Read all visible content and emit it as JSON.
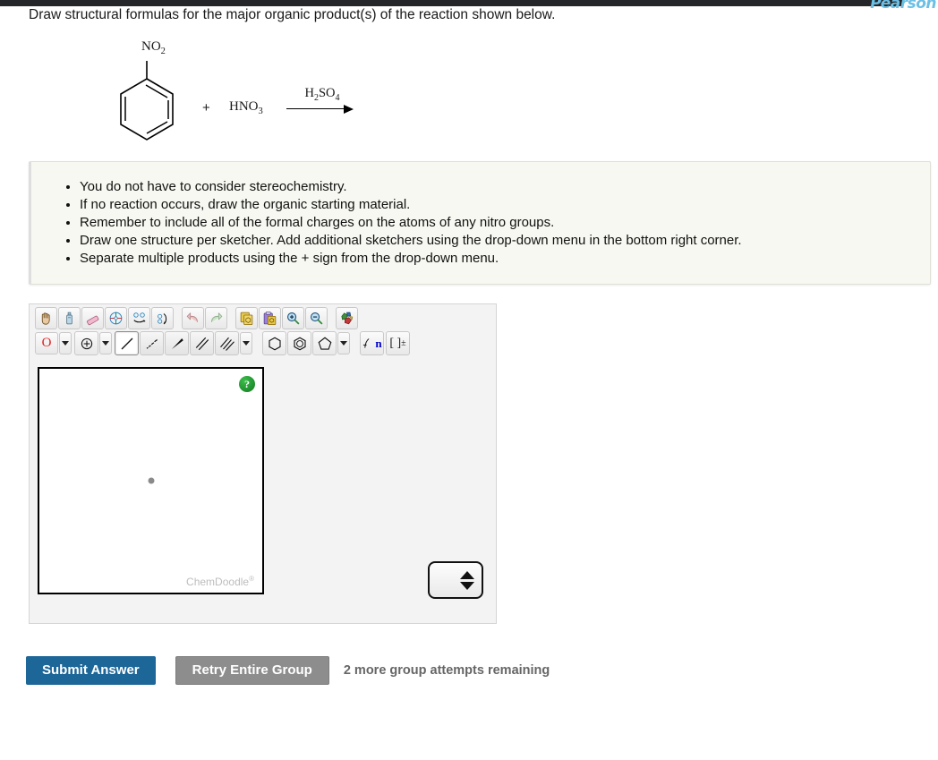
{
  "header": {
    "brand": "Pearson",
    "prompt": "Draw structural formulas for the major organic product(s) of the reaction shown below."
  },
  "reaction": {
    "substituent_label": "NO",
    "substituent_sub": "2",
    "plus": "+",
    "reagent": "HNO",
    "reagent_sub": "3",
    "catalyst": "H",
    "catalyst_sub1": "2",
    "catalyst_mid": "SO",
    "catalyst_sub2": "4",
    "arrow": "reaction-arrow"
  },
  "instructions": {
    "bullets": [
      "You do not have to consider stereochemistry.",
      "If no reaction occurs, draw the organic starting material.",
      "Remember to include all of the formal charges on the atoms of any nitro groups.",
      "Draw one structure per sketcher. Add additional sketchers using the drop-down menu in the bottom right corner.",
      "Separate multiple products using the + sign from the drop-down menu."
    ]
  },
  "sketcher": {
    "toolbar_row1": [
      {
        "name": "pan-hand-icon",
        "label": "Move/Pan"
      },
      {
        "name": "clear-icon",
        "label": "Clear"
      },
      {
        "name": "eraser-icon",
        "label": "Erase"
      },
      {
        "name": "center-icon",
        "label": "Center"
      },
      {
        "name": "flip-horizontal-icon",
        "label": "Flip Horizontal"
      },
      {
        "name": "flip-vertical-icon",
        "label": "Flip Vertical"
      },
      {
        "name": "undo-icon",
        "label": "Undo"
      },
      {
        "name": "redo-icon",
        "label": "Redo"
      },
      {
        "name": "copy-icon",
        "label": "Copy"
      },
      {
        "name": "paste-icon",
        "label": "Paste"
      },
      {
        "name": "zoom-in-icon",
        "label": "Zoom In"
      },
      {
        "name": "zoom-out-icon",
        "label": "Zoom Out"
      },
      {
        "name": "templates-icon",
        "label": "Templates"
      }
    ],
    "atom_label": "O",
    "charge_label": "charge-tool",
    "bond_tools": [
      {
        "name": "single-bond-tool",
        "label": "Single Bond",
        "selected": true
      },
      {
        "name": "hash-bond-tool",
        "label": "Hashed Bond",
        "selected": false
      },
      {
        "name": "wedge-bond-tool",
        "label": "Wedge Bond",
        "selected": false
      },
      {
        "name": "double-bond-tool",
        "label": "Double Bond",
        "selected": false
      },
      {
        "name": "triple-bond-tool",
        "label": "Triple Bond",
        "selected": false
      }
    ],
    "ring_tools": [
      {
        "name": "cyclohexane-ring-tool",
        "label": "Cyclohexane"
      },
      {
        "name": "benzene-ring-tool",
        "label": "Benzene"
      },
      {
        "name": "cyclopentane-ring-tool",
        "label": "Cyclopentane"
      }
    ],
    "chain_label": "n",
    "bracket_label": "[ ]",
    "bracket_sup": "±",
    "help_badge": "?",
    "watermark": "ChemDoodle",
    "watermark_sup": "®",
    "spinner": "add-sketcher-spinner"
  },
  "footer": {
    "submit_label": "Submit Answer",
    "retry_label": "Retry Entire Group",
    "attempts_text": "2 more group attempts remaining"
  },
  "colors": {
    "submit_blue": "#1c6698",
    "retry_gray": "#8d8d8d",
    "help_green": "#117a22",
    "atom_red": "#e02020",
    "brand_blue": "#6cc0e5"
  }
}
